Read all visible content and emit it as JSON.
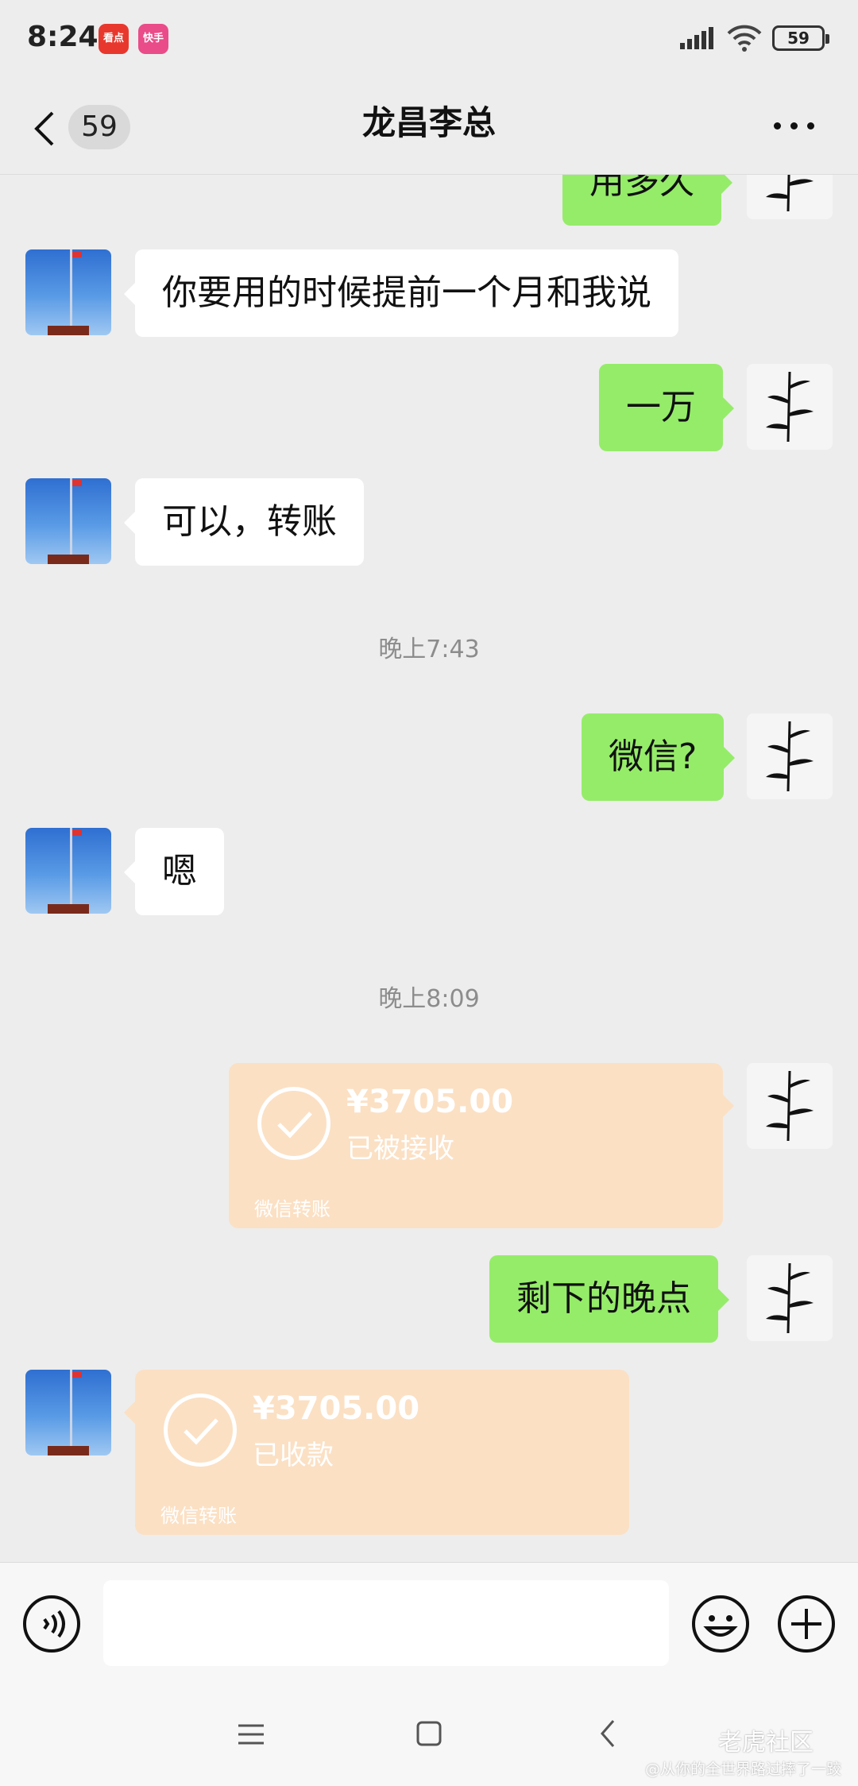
{
  "status_bar": {
    "time": "8:24",
    "app_icons": [
      "看点",
      "快手"
    ],
    "battery": "59"
  },
  "header": {
    "back_badge": "59",
    "title": "龙昌李总",
    "more_icon": "more-icon"
  },
  "messages": {
    "m0": {
      "side": "right",
      "text": "用多久"
    },
    "m1": {
      "side": "left",
      "text": "你要用的时候提前一个月和我说"
    },
    "m2": {
      "side": "right",
      "text": "一万"
    },
    "m3": {
      "side": "left",
      "text": "可以，转账"
    },
    "t1": "晚上7:43",
    "m4": {
      "side": "right",
      "text": "微信?"
    },
    "m5": {
      "side": "left",
      "text": "嗯"
    },
    "t2": "晚上8:09",
    "transfer1": {
      "side": "right",
      "amount": "¥3705.00",
      "status": "已被接收",
      "footer": "微信转账"
    },
    "m6": {
      "side": "right",
      "text": "剩下的晚点"
    },
    "transfer2": {
      "side": "left",
      "amount": "¥3705.00",
      "status": "已收款",
      "footer": "微信转账"
    }
  },
  "input_bar": {
    "value": "",
    "icons": [
      "voice-icon",
      "emoji-icon",
      "plus-icon"
    ]
  },
  "system_nav": [
    "menu-icon",
    "home-icon",
    "back-icon"
  ],
  "watermark": {
    "brand": "老虎社区",
    "credit": "@从你的全世界路过摔了一跤"
  },
  "colors": {
    "background": "#ededed",
    "bubble_green": "#95ec69",
    "bubble_white": "#ffffff",
    "transfer_bg": "#fbe0c4"
  }
}
